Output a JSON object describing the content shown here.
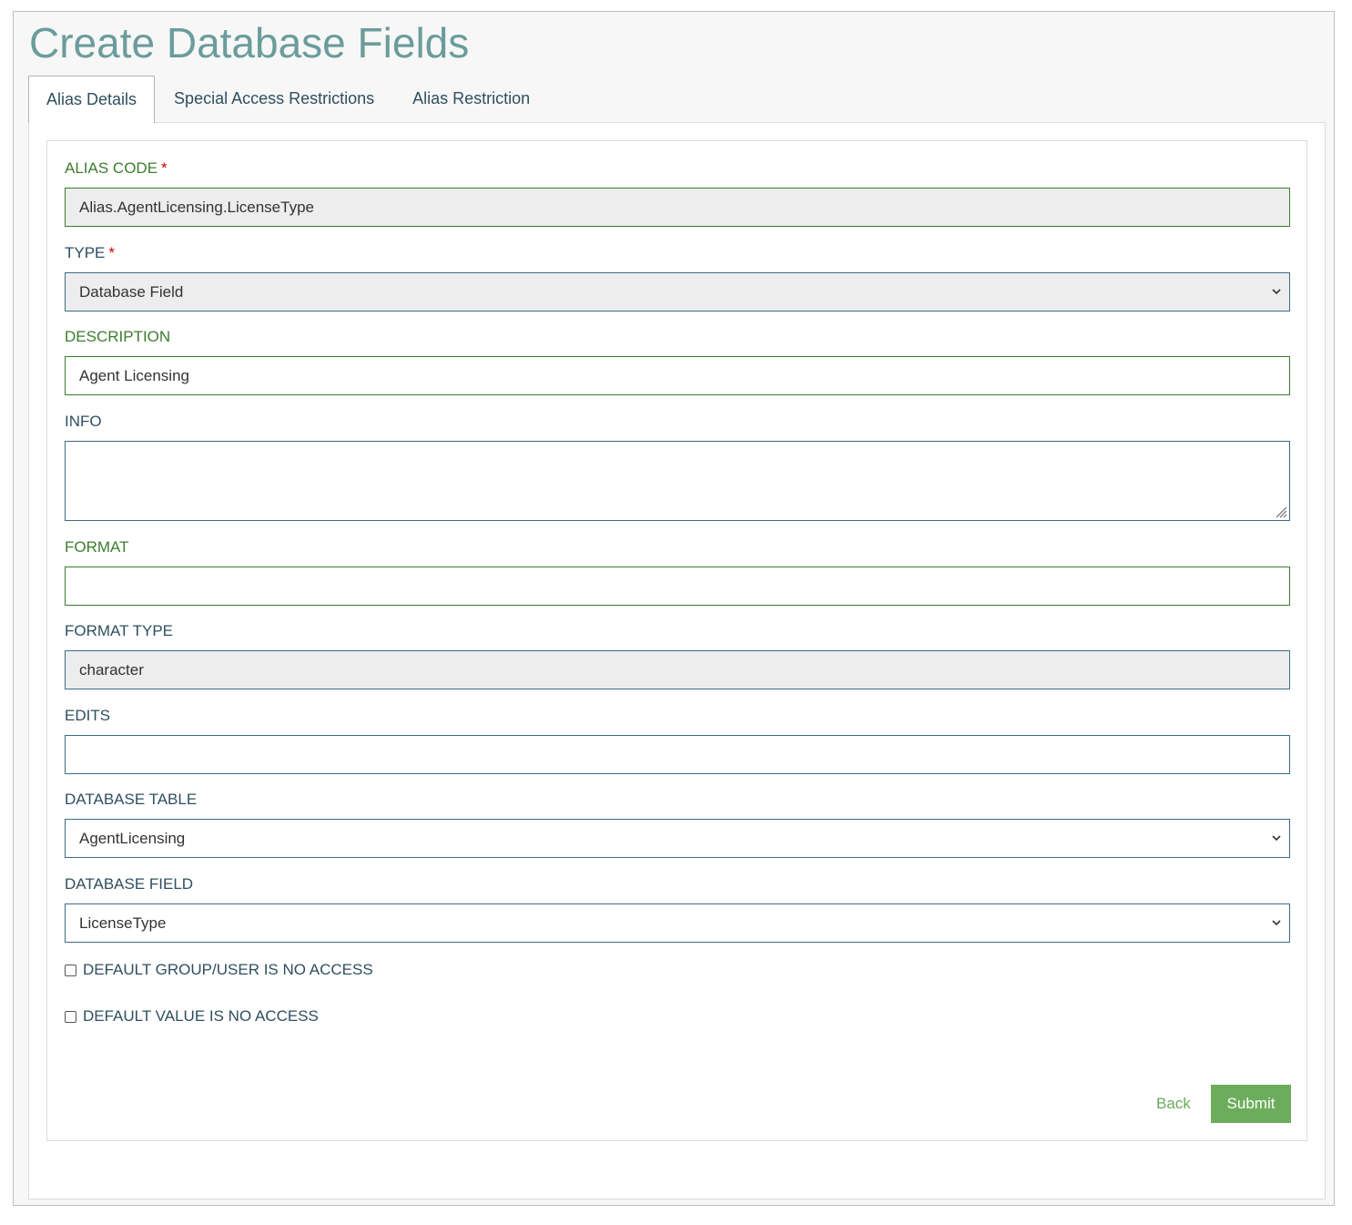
{
  "page": {
    "title": "Create Database Fields"
  },
  "tabs": [
    {
      "label": "Alias Details",
      "active": true
    },
    {
      "label": "Special Access Restrictions",
      "active": false
    },
    {
      "label": "Alias Restriction",
      "active": false
    }
  ],
  "form": {
    "alias_code": {
      "label": "ALIAS CODE",
      "required_mark": "*",
      "value": "Alias.AgentLicensing.LicenseType",
      "readonly": true
    },
    "type": {
      "label": "TYPE",
      "required_mark": "*",
      "value": "Database Field"
    },
    "description": {
      "label": "DESCRIPTION",
      "value": "Agent Licensing"
    },
    "info": {
      "label": "INFO",
      "value": ""
    },
    "format": {
      "label": "FORMAT",
      "value": ""
    },
    "format_type": {
      "label": "FORMAT TYPE",
      "value": "character",
      "readonly": true
    },
    "edits": {
      "label": "EDITS",
      "value": ""
    },
    "database_table": {
      "label": "DATABASE TABLE",
      "value": "AgentLicensing"
    },
    "database_field": {
      "label": "DATABASE FIELD",
      "value": "LicenseType"
    },
    "default_group_user_no_access": {
      "label": "DEFAULT GROUP/USER IS NO ACCESS",
      "checked": false
    },
    "default_value_no_access": {
      "label": "DEFAULT VALUE IS NO ACCESS",
      "checked": false
    }
  },
  "actions": {
    "back_label": "Back",
    "submit_label": "Submit"
  },
  "colors": {
    "title": "#6b9c9c",
    "label_green": "#3c7d2e",
    "required": "#cc0000",
    "submit_bg": "#6cad5c",
    "back_link": "#6aaa5c"
  }
}
